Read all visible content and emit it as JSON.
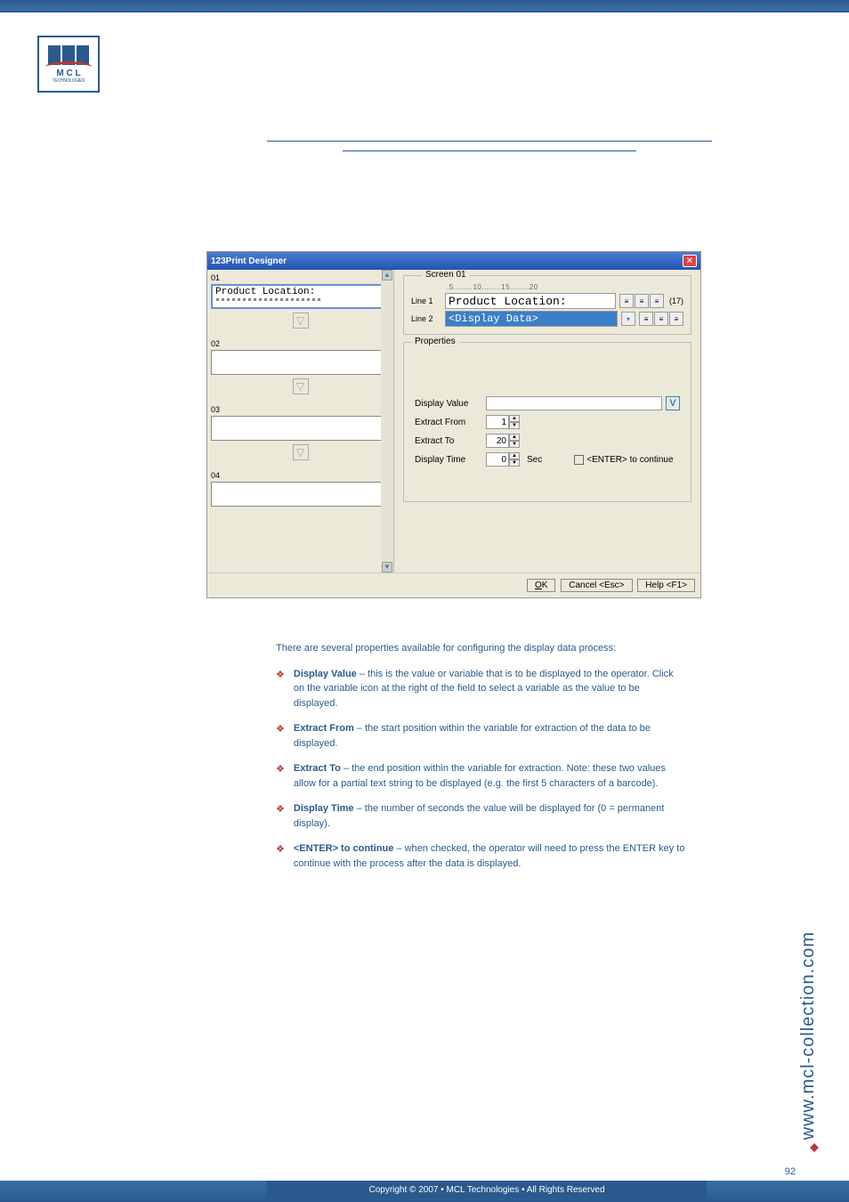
{
  "header": {
    "logo_main": "M C L",
    "logo_sub": "TECHNOLOGIES",
    "underline_text": ""
  },
  "dialog": {
    "title": "123Print Designer",
    "thumbs": [
      {
        "num": "01",
        "text": "Product Location:",
        "selected": true,
        "dots": true
      },
      {
        "num": "02",
        "text": "",
        "selected": false,
        "dots": false
      },
      {
        "num": "03",
        "text": "",
        "selected": false,
        "dots": false
      },
      {
        "num": "04",
        "text": "",
        "selected": false,
        "dots": false
      }
    ],
    "screen_legend": "Screen 01",
    "ruler": ".5........10........15........20",
    "line1_label": "Line 1",
    "line1_value": "Product Location:",
    "line1_count": "(17)",
    "line2_label": "Line 2",
    "line2_value": "<Display Data>",
    "props_legend": "Properties",
    "prop_display_value": "Display Value",
    "prop_extract_from": "Extract From",
    "prop_extract_to": "Extract To",
    "prop_display_time": "Display Time",
    "extract_from_val": "1",
    "extract_to_val": "20",
    "display_time_val": "0",
    "display_time_unit": "Sec",
    "enter_continue": "<ENTER> to continue",
    "btn_ok": "OK",
    "btn_cancel": "Cancel <Esc>",
    "btn_help": "Help <F1>"
  },
  "body": {
    "intro": "There are several properties available for configuring the display data process:",
    "bullets": [
      {
        "label": "Display Value",
        "text": " – this is the value or variable that is to be displayed to the operator.  Click on the variable icon at the right of the field to select a variable as the value to be displayed."
      },
      {
        "label": "Extract From",
        "text": " – the start position within the variable for extraction of the data to be displayed."
      },
      {
        "label": "Extract To",
        "text": " – the end position within the variable for extraction.  Note: these two values allow for a partial text string to be displayed (e.g. the first 5 characters of a barcode)."
      },
      {
        "label": "Display Time",
        "text": " – the number of seconds the value will be displayed for (0 = permanent display)."
      },
      {
        "label": "<ENTER> to continue",
        "text": " – when checked, the operator will need to press the ENTER key to continue with the process after the data is displayed."
      }
    ]
  },
  "footer": {
    "copyright": "Copyright © 2007 • MCL Technologies • All Rights Reserved",
    "url": "www.mcl-collection.com",
    "page": "92"
  }
}
